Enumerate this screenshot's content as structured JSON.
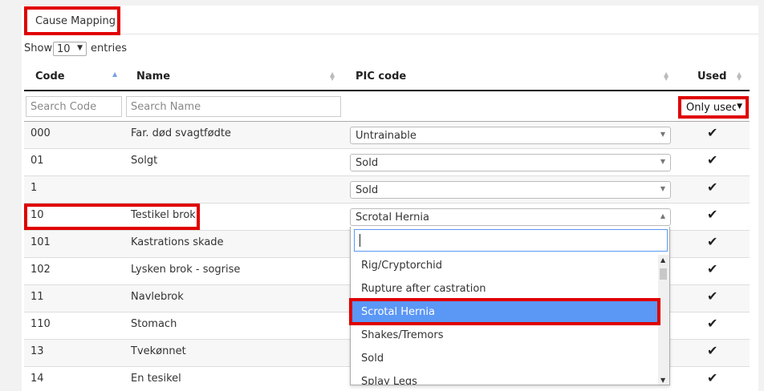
{
  "title": "Cause Mapping",
  "length_menu": {
    "before": "Show",
    "value": "10",
    "after": "entries"
  },
  "columns": {
    "code": "Code",
    "name": "Name",
    "pic": "PIC code",
    "used": "Used"
  },
  "filters": {
    "code_placeholder": "Search Code",
    "name_placeholder": "Search Name",
    "used_value": "Only used"
  },
  "rows": [
    {
      "code": "000",
      "name": "Far. død svagtfødte",
      "pic": "Untrainable",
      "used": "✔"
    },
    {
      "code": "01",
      "name": "Solgt",
      "pic": "Sold",
      "used": "✔"
    },
    {
      "code": "1",
      "name": "",
      "pic": "Sold",
      "used": "✔"
    },
    {
      "code": "10",
      "name": "Testikel brok",
      "pic": "Scrotal Hernia",
      "used": "✔"
    },
    {
      "code": "101",
      "name": "Kastrations skade",
      "pic": "",
      "used": "✔"
    },
    {
      "code": "102",
      "name": "Lysken brok - sogrise",
      "pic": "",
      "used": "✔"
    },
    {
      "code": "11",
      "name": "Navlebrok",
      "pic": "",
      "used": "✔"
    },
    {
      "code": "110",
      "name": "Stomach",
      "pic": "",
      "used": "✔"
    },
    {
      "code": "13",
      "name": "Tvekønnet",
      "pic": "",
      "used": "✔"
    },
    {
      "code": "14",
      "name": "En tesikel",
      "pic": "",
      "used": "✔"
    }
  ],
  "dropdown": {
    "search_value": "",
    "options": [
      "Rig/Cryptorchid",
      "Rupture after castration",
      "Scrotal Hernia",
      "Shakes/Tremors",
      "Sold",
      "Splay Legs"
    ],
    "selected": "Scrotal Hernia"
  },
  "colors": {
    "highlight": "#e00000",
    "selected_option": "#5b97f5",
    "sort_active": "#7aa0e6"
  }
}
